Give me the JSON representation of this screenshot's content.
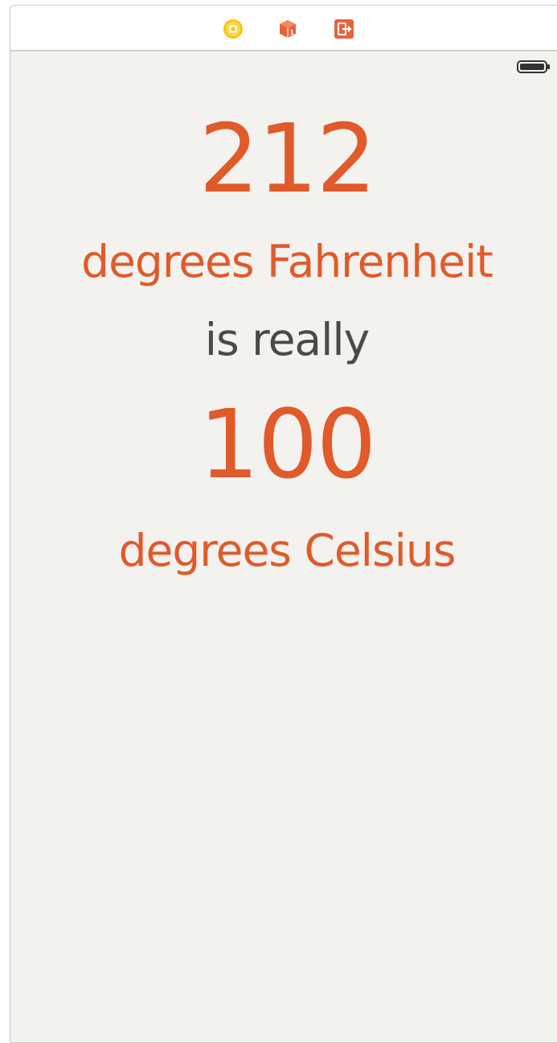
{
  "scene_dock": {
    "icons": [
      {
        "name": "view-controller-icon",
        "color": "#f5c518"
      },
      {
        "name": "first-responder-icon",
        "color": "#e8633a"
      },
      {
        "name": "exit-icon",
        "color": "#e8633a"
      }
    ]
  },
  "status_bar": {
    "battery_icon": "battery-icon"
  },
  "converter": {
    "fahrenheit_value": "212",
    "fahrenheit_label": "degrees Fahrenheit",
    "connector": "is really",
    "celsius_value": "100",
    "celsius_label": "degrees Celsius"
  },
  "colors": {
    "accent": "#e05a2a",
    "connector_text": "#4a4a4a",
    "background": "#f3f2ef"
  }
}
